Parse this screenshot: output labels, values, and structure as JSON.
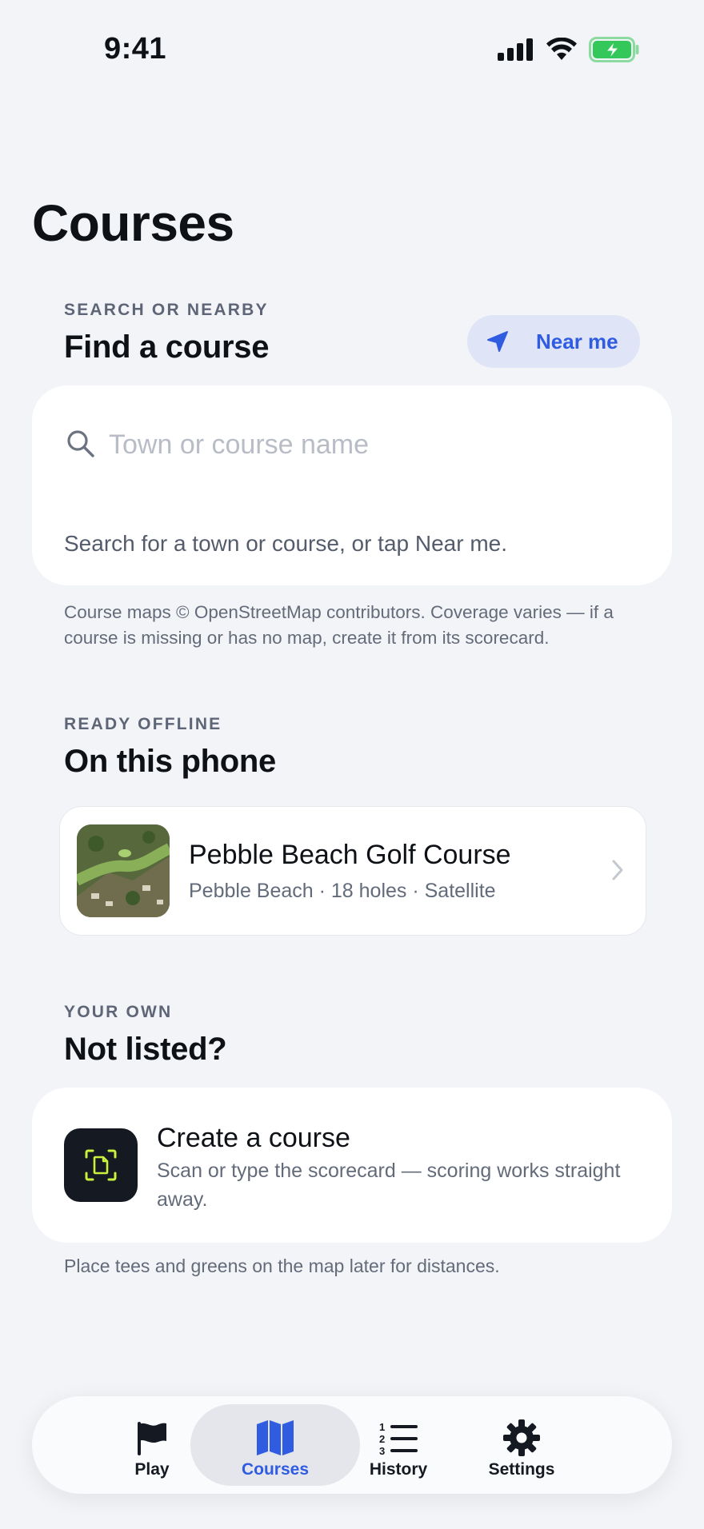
{
  "status_bar": {
    "time": "9:41"
  },
  "page": {
    "title": "Courses"
  },
  "find_section": {
    "eyebrow": "SEARCH OR NEARBY",
    "title": "Find a course",
    "near_me_label": "Near me",
    "search_placeholder": "Town or course name",
    "search_value": "",
    "hint": "Search for a town or course, or tap Near me.",
    "attribution": "Course maps © OpenStreetMap contributors. Coverage varies — if a course is missing or has no map, create it from its scorecard."
  },
  "offline_section": {
    "eyebrow": "READY OFFLINE",
    "title": "On this phone",
    "courses": [
      {
        "name": "Pebble Beach Golf Course",
        "meta": "Pebble Beach · 18 holes · Satellite"
      }
    ]
  },
  "own_section": {
    "eyebrow": "YOUR OWN",
    "title": "Not listed?",
    "create_title": "Create a course",
    "create_desc": "Scan or type the scorecard — scoring works straight away.",
    "footnote": "Place tees and greens on the map later for distances."
  },
  "tab_bar": {
    "tabs": [
      {
        "label": "Play",
        "icon": "flag-icon"
      },
      {
        "label": "Courses",
        "icon": "map-icon",
        "active": true
      },
      {
        "label": "History",
        "icon": "numbered-list-icon"
      },
      {
        "label": "Settings",
        "icon": "gear-icon"
      }
    ]
  },
  "colors": {
    "background": "#f3f4f7",
    "accent": "#2f5ce0",
    "accent_soft": "#dfe5f7",
    "battery_green": "#34c759",
    "scan_icon_lime": "#c8f03c"
  }
}
